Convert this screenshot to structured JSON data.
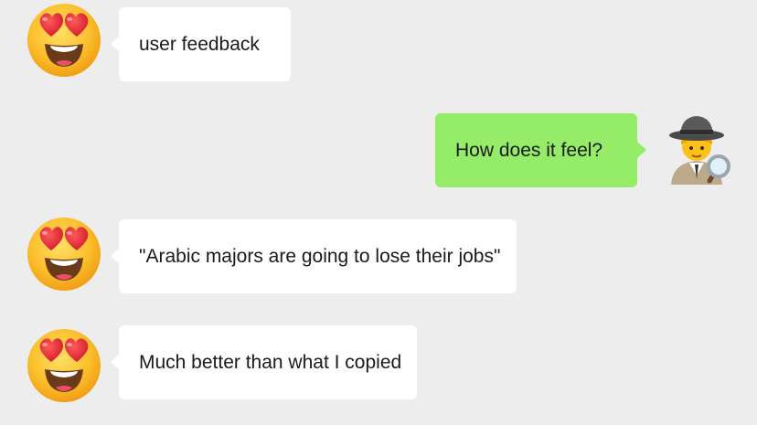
{
  "chat": {
    "messages": [
      {
        "side": "left",
        "avatar": "heart-eyes-emoji",
        "text": "user feedback"
      },
      {
        "side": "right",
        "avatar": "detective-emoji",
        "text": "How does it feel?"
      },
      {
        "side": "left",
        "avatar": "heart-eyes-emoji",
        "text": "\"Arabic majors are going to lose their jobs\""
      },
      {
        "side": "left",
        "avatar": "heart-eyes-emoji",
        "text": "Much better than what I copied"
      }
    ]
  },
  "colors": {
    "background": "#ededed",
    "incoming_bubble": "#ffffff",
    "outgoing_bubble": "#95ec69",
    "text": "#1a1a1a"
  }
}
